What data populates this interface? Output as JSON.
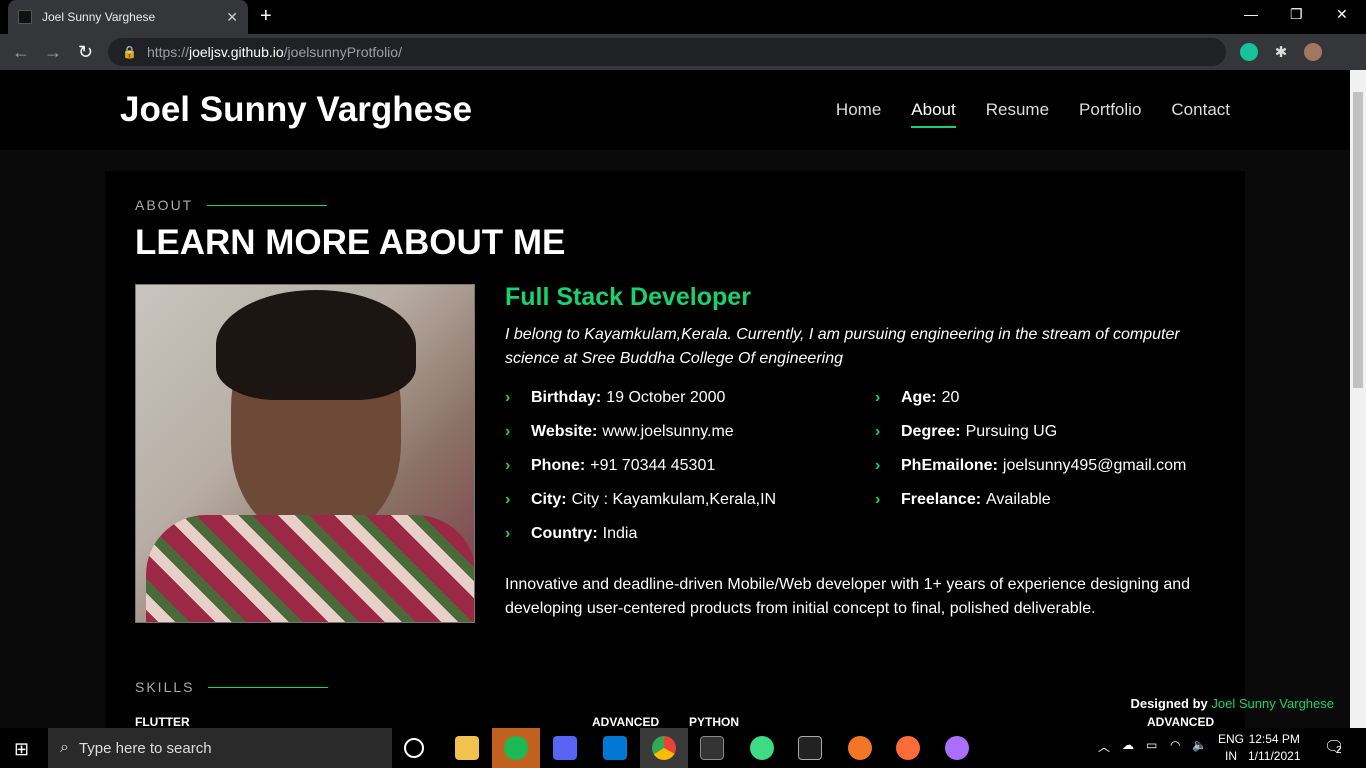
{
  "browser": {
    "tab_title": "Joel Sunny Varghese",
    "tab_close": "✕",
    "new_tab": "+",
    "url_prefix": "https://",
    "url_host": "joeljsv.github.io",
    "url_path": "/joelsunnyProtfolio/",
    "back": "←",
    "forward": "→",
    "reload": "↻",
    "min": "—",
    "max": "❐",
    "close": "✕"
  },
  "site": {
    "logo": "Joel Sunny Varghese",
    "nav": [
      "Home",
      "About",
      "Resume",
      "Portfolio",
      "Contact"
    ],
    "active_nav": "About"
  },
  "about": {
    "label": "ABOUT",
    "title": "LEARN MORE ABOUT ME",
    "role": "Full Stack Developer",
    "intro": "I belong to Kayamkulam,Kerala. Currently, I am pursuing engineering in the stream of computer science at Sree Buddha College Of engineering",
    "left_facts": [
      {
        "label": "Birthday:",
        "value": "19 October 2000"
      },
      {
        "label": "Website:",
        "value": "www.joelsunny.me"
      },
      {
        "label": "Phone:",
        "value": "+91 70344 45301"
      },
      {
        "label": "City:",
        "value": "City : Kayamkulam,Kerala,IN"
      },
      {
        "label": "Country:",
        "value": "India"
      }
    ],
    "right_facts": [
      {
        "label": "Age:",
        "value": "20"
      },
      {
        "label": "Degree:",
        "value": "Pursuing UG"
      },
      {
        "label": "PhEmailone:",
        "value": "joelsunny495@gmail.com"
      },
      {
        "label": "Freelance:",
        "value": "Available"
      }
    ],
    "summary": "Innovative and deadline-driven Mobile/Web developer with 1+ years of experience designing and developing user-centered products from initial concept to final, polished deliverable."
  },
  "skills": {
    "label": "SKILLS",
    "items": [
      {
        "name": "FLUTTER",
        "level": "ADVANCED"
      },
      {
        "name": "PYTHON",
        "level": "ADVANCED"
      }
    ]
  },
  "footer": {
    "designed_by": "Designed by",
    "author": "Joel Sunny Varghese"
  },
  "taskbar": {
    "search_placeholder": "Type here to search",
    "lang_top": "ENG",
    "lang_bottom": "IN",
    "time": "12:54 PM",
    "date": "1/11/2021",
    "notif_count": "2"
  },
  "colors": {
    "accent": "#18d26e",
    "background": "#000000"
  }
}
